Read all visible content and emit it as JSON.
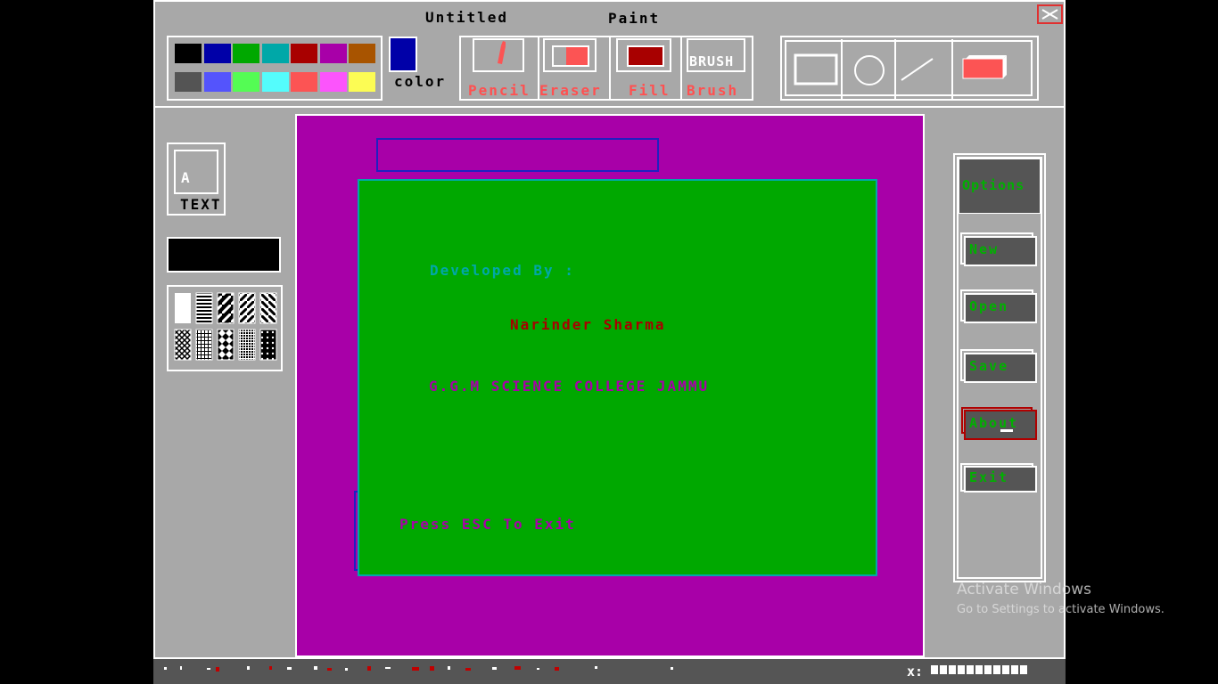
{
  "window": {
    "title_left": "Untitled",
    "title_right": "Paint",
    "close_icon": "close-icon"
  },
  "palette": {
    "colors_top": [
      "#000000",
      "#0000a8",
      "#00a800",
      "#00a8a8",
      "#a80000",
      "#a800a8",
      "#a85400"
    ],
    "colors_bottom": [
      "#545454",
      "#5454fc",
      "#54fc54",
      "#54fcfc",
      "#fc5454",
      "#fc54fc",
      "#fcfc54"
    ],
    "current_color": "#0000a8",
    "current_color_label": "color"
  },
  "tools": {
    "pencil": "Pencil",
    "eraser": "Eraser",
    "fill": "Fill",
    "brush": "Brush",
    "brush_icon_text": "BRUSH"
  },
  "left_panel": {
    "text_icon_letter": "A",
    "text_label": "TEXT"
  },
  "canvas": {
    "background": "#a800a8",
    "dialog_background": "#00a800",
    "developed_by": "Developed By :",
    "author": "Narinder Sharma",
    "college": "G.G.M SCIENCE COLLEGE JAMMU",
    "press_esc": "Press ESC To Exit"
  },
  "options": {
    "header": "Options",
    "new": "New",
    "open": "Open",
    "save": "Save",
    "about": "About",
    "exit": "Exit"
  },
  "watermark": {
    "line1": "Activate Windows",
    "line2": "Go to Settings to activate Windows."
  },
  "status": {
    "coords": "x:"
  }
}
